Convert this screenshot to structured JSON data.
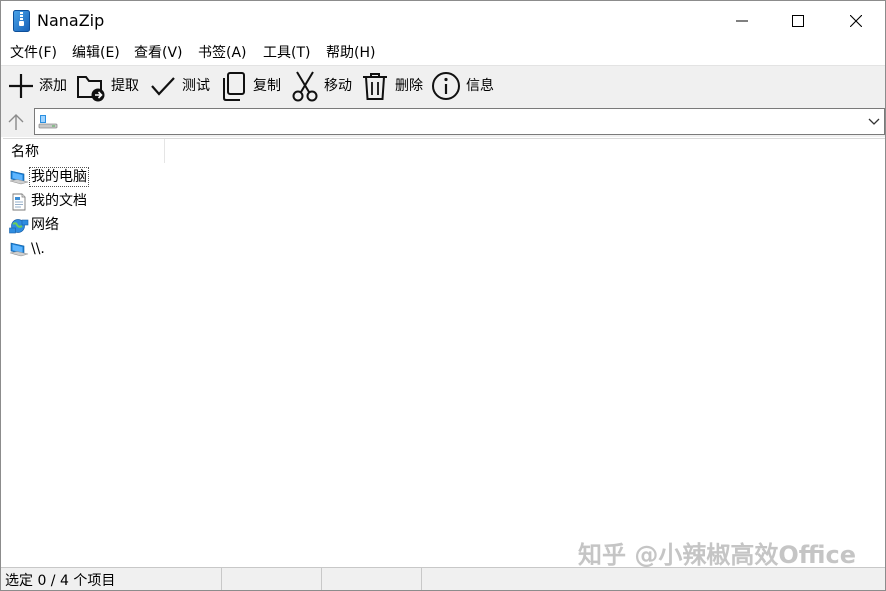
{
  "window": {
    "title": "NanaZip"
  },
  "menu": [
    {
      "label": "文件(F)"
    },
    {
      "label": "编辑(E)"
    },
    {
      "label": "查看(V)"
    },
    {
      "label": "书签(A)"
    },
    {
      "label": "工具(T)"
    },
    {
      "label": "帮助(H)"
    }
  ],
  "toolbar": [
    {
      "label": "添加",
      "icon": "plus-icon"
    },
    {
      "label": "提取",
      "icon": "extract-folder-icon"
    },
    {
      "label": "测试",
      "icon": "checkmark-icon"
    },
    {
      "label": "复制",
      "icon": "copy-icon"
    },
    {
      "label": "移动",
      "icon": "scissors-icon"
    },
    {
      "label": "删除",
      "icon": "trash-icon"
    },
    {
      "label": "信息",
      "icon": "info-icon"
    }
  ],
  "address": {
    "value": "",
    "icon": "computer-drive-icon"
  },
  "list": {
    "columns": [
      {
        "label": "名称"
      }
    ],
    "items": [
      {
        "label": "我的电脑",
        "icon": "computer-icon",
        "focused": true
      },
      {
        "label": "我的文档",
        "icon": "document-icon",
        "focused": false
      },
      {
        "label": "网络",
        "icon": "network-icon",
        "focused": false
      },
      {
        "label": "\\\\.",
        "icon": "computer-icon",
        "focused": false
      }
    ]
  },
  "status": {
    "selection": "选定 0 / 4 个项目"
  },
  "watermark": "知乎 @小辣椒高效Office"
}
